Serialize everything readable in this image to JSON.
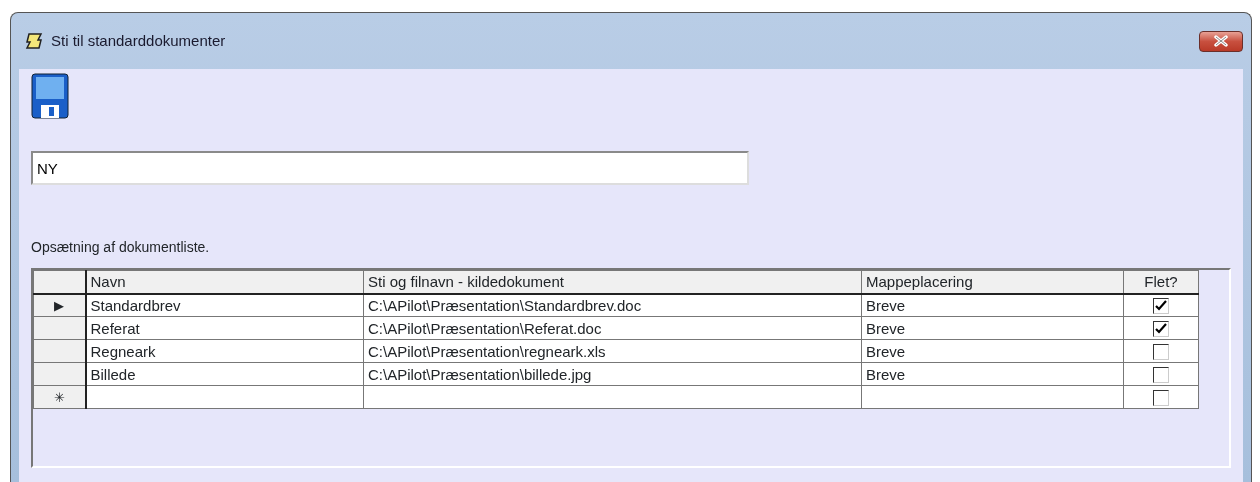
{
  "window": {
    "title": "Sti til standarddokumenter"
  },
  "name_field": {
    "value": "NY"
  },
  "list_label": "Opsætning af dokumentliste.",
  "table": {
    "columns": [
      "Navn",
      "Sti og filnavn - kildedokument",
      "Mappeplacering",
      "Flet?"
    ],
    "rows": [
      {
        "marker": "▶",
        "cells": [
          "Standardbrev",
          "C:\\APilot\\Præsentation\\Standardbrev.doc",
          "Breve"
        ],
        "checked": true
      },
      {
        "cells": [
          "Referat",
          "C:\\APilot\\Præsentation\\Referat.doc",
          "Breve"
        ],
        "checked": true
      },
      {
        "cells": [
          "Regneark",
          "C:\\APilot\\Præsentation\\regneark.xls",
          "Breve"
        ],
        "checked": false
      },
      {
        "cells": [
          "Billede",
          "C:\\APilot\\Præsentation\\billede.jpg",
          "Breve"
        ],
        "checked": false
      },
      {
        "marker": "✳",
        "cells": [
          "",
          "",
          ""
        ],
        "checked": false
      }
    ]
  }
}
